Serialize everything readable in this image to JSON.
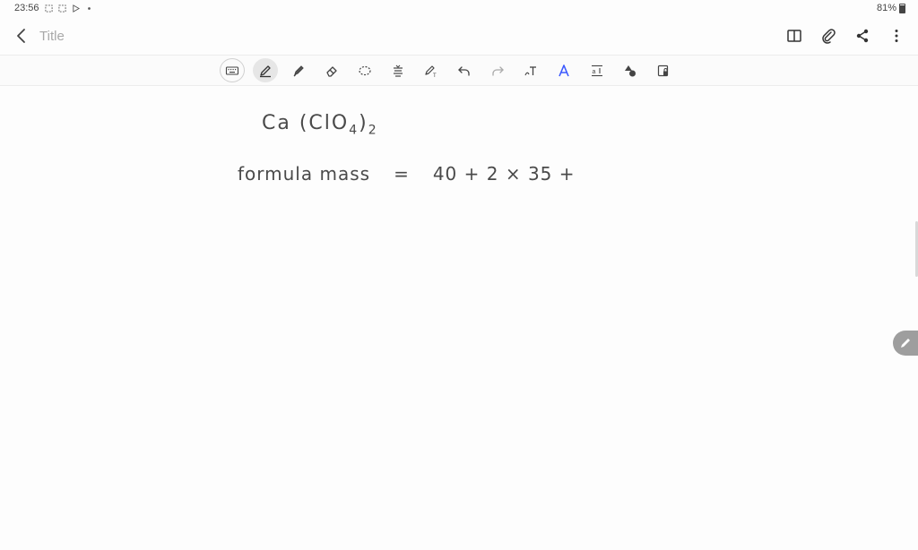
{
  "status": {
    "time": "23:56",
    "battery": "81%"
  },
  "header": {
    "title_placeholder": "Title",
    "icons": [
      "back-icon",
      "book-icon",
      "paperclip-icon",
      "share-icon",
      "more-icon"
    ]
  },
  "toolbar": {
    "tools": [
      {
        "name": "keyboard-icon"
      },
      {
        "name": "pen-icon",
        "active": true
      },
      {
        "name": "highlighter-icon"
      },
      {
        "name": "eraser-icon"
      },
      {
        "name": "lasso-icon"
      },
      {
        "name": "text-align-icon"
      },
      {
        "name": "pen-text-icon"
      },
      {
        "name": "undo-icon"
      },
      {
        "name": "redo-icon"
      },
      {
        "name": "handwriting-to-text-icon"
      },
      {
        "name": "text-style-icon"
      },
      {
        "name": "text-spacing-icon"
      },
      {
        "name": "shapes-icon"
      },
      {
        "name": "lock-icon"
      }
    ]
  },
  "canvas": {
    "line1_main": "Ca (ClO",
    "line1_sub1": "4",
    "line1_close": ")",
    "line1_sub2": "2",
    "line2_label": "formula mass",
    "line2_equals": "=",
    "line2_expr": "40 + 2 × 35 +"
  },
  "colors": {
    "accent": "#3d5afe",
    "ink": "#4a4a4a"
  }
}
